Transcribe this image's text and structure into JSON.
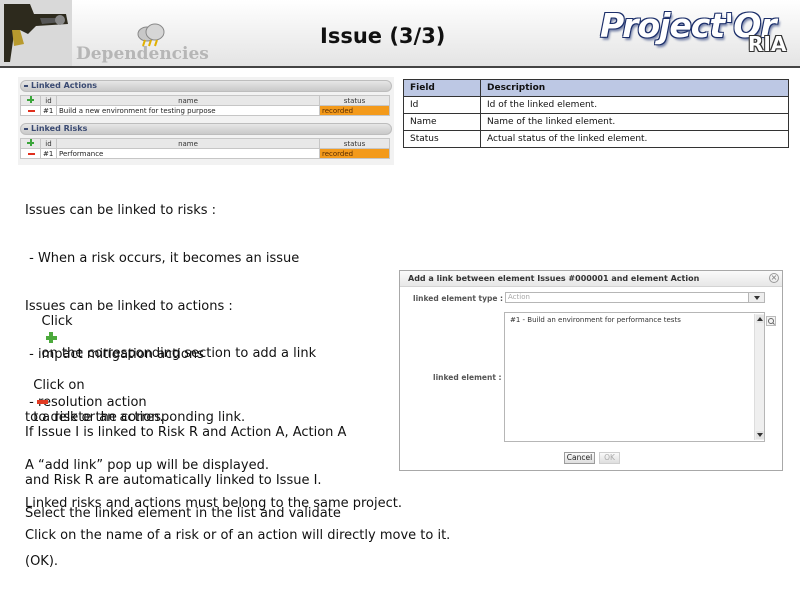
{
  "header": {
    "section_label": "Dependencies",
    "title": "Issue (3/3)",
    "brand": "Project'Or",
    "brand_sub": "RIA"
  },
  "linked_panel": {
    "actions": {
      "heading": "Linked Actions",
      "columns": [
        "id",
        "name",
        "status"
      ],
      "rows": [
        {
          "id": "#1",
          "name": "Build a new environment for testing purpose",
          "status": "recorded"
        }
      ]
    },
    "risks": {
      "heading": "Linked Risks",
      "columns": [
        "id",
        "name",
        "status"
      ],
      "rows": [
        {
          "id": "#1",
          "name": "Performance",
          "status": "recorded"
        }
      ]
    },
    "colors": {
      "status_bg": "#f39a1b",
      "add": "#3aa53a",
      "remove": "#e0301e"
    }
  },
  "field_table": {
    "headers": [
      "Field",
      "Description"
    ],
    "rows": [
      {
        "field": "Id",
        "description": "Id of the linked element."
      },
      {
        "field": "Name",
        "description": "Name of the linked element."
      },
      {
        "field": "Status",
        "description": "Actual status of the linked element."
      }
    ],
    "header_color": "#bdc8e4"
  },
  "text": {
    "intro": [
      "Issues can be linked to risks :",
      " - When a risk occurs, it becomes an issue",
      "Issues can be linked to actions :",
      " - impact mitigation actions",
      " - resolution action"
    ],
    "add_prefix": "Click",
    "add_suffix": "on the corresponding section to add a link",
    "add_cont": [
      "to a risk or an action.",
      "A “add link” pop up will be displayed.",
      "Select the linked element in the list and validate",
      "(OK)."
    ],
    "delete_prefix": "Click on",
    "delete_suffix": "to delete the corresponding link.",
    "auto_link": [
      "If Issue I is linked to Risk R and Action A, Action A",
      "and Risk R are automatically linked to Issue I."
    ],
    "same_project": "Linked risks and actions must belong to the same project.",
    "navigate": "Click on the name of a risk or of an action will directly move to it."
  },
  "dialog": {
    "title": "Add a link between element Issues #000001 and element Action",
    "type_label": "linked element type :",
    "type_value": "Action",
    "element_label": "linked element :",
    "element_option": "#1 - Build an environment for performance tests",
    "cancel": "Cancel",
    "ok": "OK"
  }
}
